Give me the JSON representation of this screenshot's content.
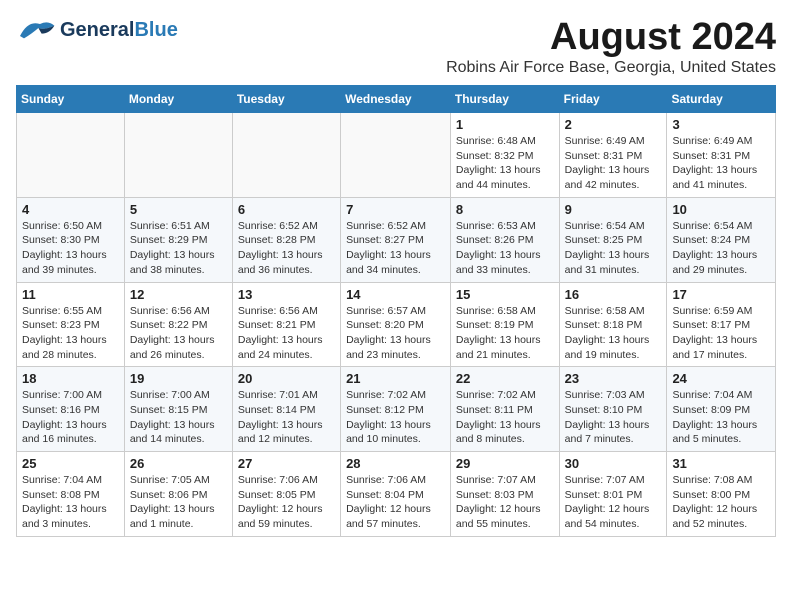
{
  "header": {
    "logo_line1": "General",
    "logo_line2": "Blue",
    "month": "August 2024",
    "location": "Robins Air Force Base, Georgia, United States"
  },
  "weekdays": [
    "Sunday",
    "Monday",
    "Tuesday",
    "Wednesday",
    "Thursday",
    "Friday",
    "Saturday"
  ],
  "weeks": [
    [
      {
        "day": "",
        "info": ""
      },
      {
        "day": "",
        "info": ""
      },
      {
        "day": "",
        "info": ""
      },
      {
        "day": "",
        "info": ""
      },
      {
        "day": "1",
        "info": "Sunrise: 6:48 AM\nSunset: 8:32 PM\nDaylight: 13 hours\nand 44 minutes."
      },
      {
        "day": "2",
        "info": "Sunrise: 6:49 AM\nSunset: 8:31 PM\nDaylight: 13 hours\nand 42 minutes."
      },
      {
        "day": "3",
        "info": "Sunrise: 6:49 AM\nSunset: 8:31 PM\nDaylight: 13 hours\nand 41 minutes."
      }
    ],
    [
      {
        "day": "4",
        "info": "Sunrise: 6:50 AM\nSunset: 8:30 PM\nDaylight: 13 hours\nand 39 minutes."
      },
      {
        "day": "5",
        "info": "Sunrise: 6:51 AM\nSunset: 8:29 PM\nDaylight: 13 hours\nand 38 minutes."
      },
      {
        "day": "6",
        "info": "Sunrise: 6:52 AM\nSunset: 8:28 PM\nDaylight: 13 hours\nand 36 minutes."
      },
      {
        "day": "7",
        "info": "Sunrise: 6:52 AM\nSunset: 8:27 PM\nDaylight: 13 hours\nand 34 minutes."
      },
      {
        "day": "8",
        "info": "Sunrise: 6:53 AM\nSunset: 8:26 PM\nDaylight: 13 hours\nand 33 minutes."
      },
      {
        "day": "9",
        "info": "Sunrise: 6:54 AM\nSunset: 8:25 PM\nDaylight: 13 hours\nand 31 minutes."
      },
      {
        "day": "10",
        "info": "Sunrise: 6:54 AM\nSunset: 8:24 PM\nDaylight: 13 hours\nand 29 minutes."
      }
    ],
    [
      {
        "day": "11",
        "info": "Sunrise: 6:55 AM\nSunset: 8:23 PM\nDaylight: 13 hours\nand 28 minutes."
      },
      {
        "day": "12",
        "info": "Sunrise: 6:56 AM\nSunset: 8:22 PM\nDaylight: 13 hours\nand 26 minutes."
      },
      {
        "day": "13",
        "info": "Sunrise: 6:56 AM\nSunset: 8:21 PM\nDaylight: 13 hours\nand 24 minutes."
      },
      {
        "day": "14",
        "info": "Sunrise: 6:57 AM\nSunset: 8:20 PM\nDaylight: 13 hours\nand 23 minutes."
      },
      {
        "day": "15",
        "info": "Sunrise: 6:58 AM\nSunset: 8:19 PM\nDaylight: 13 hours\nand 21 minutes."
      },
      {
        "day": "16",
        "info": "Sunrise: 6:58 AM\nSunset: 8:18 PM\nDaylight: 13 hours\nand 19 minutes."
      },
      {
        "day": "17",
        "info": "Sunrise: 6:59 AM\nSunset: 8:17 PM\nDaylight: 13 hours\nand 17 minutes."
      }
    ],
    [
      {
        "day": "18",
        "info": "Sunrise: 7:00 AM\nSunset: 8:16 PM\nDaylight: 13 hours\nand 16 minutes."
      },
      {
        "day": "19",
        "info": "Sunrise: 7:00 AM\nSunset: 8:15 PM\nDaylight: 13 hours\nand 14 minutes."
      },
      {
        "day": "20",
        "info": "Sunrise: 7:01 AM\nSunset: 8:14 PM\nDaylight: 13 hours\nand 12 minutes."
      },
      {
        "day": "21",
        "info": "Sunrise: 7:02 AM\nSunset: 8:12 PM\nDaylight: 13 hours\nand 10 minutes."
      },
      {
        "day": "22",
        "info": "Sunrise: 7:02 AM\nSunset: 8:11 PM\nDaylight: 13 hours\nand 8 minutes."
      },
      {
        "day": "23",
        "info": "Sunrise: 7:03 AM\nSunset: 8:10 PM\nDaylight: 13 hours\nand 7 minutes."
      },
      {
        "day": "24",
        "info": "Sunrise: 7:04 AM\nSunset: 8:09 PM\nDaylight: 13 hours\nand 5 minutes."
      }
    ],
    [
      {
        "day": "25",
        "info": "Sunrise: 7:04 AM\nSunset: 8:08 PM\nDaylight: 13 hours\nand 3 minutes."
      },
      {
        "day": "26",
        "info": "Sunrise: 7:05 AM\nSunset: 8:06 PM\nDaylight: 13 hours\nand 1 minute."
      },
      {
        "day": "27",
        "info": "Sunrise: 7:06 AM\nSunset: 8:05 PM\nDaylight: 12 hours\nand 59 minutes."
      },
      {
        "day": "28",
        "info": "Sunrise: 7:06 AM\nSunset: 8:04 PM\nDaylight: 12 hours\nand 57 minutes."
      },
      {
        "day": "29",
        "info": "Sunrise: 7:07 AM\nSunset: 8:03 PM\nDaylight: 12 hours\nand 55 minutes."
      },
      {
        "day": "30",
        "info": "Sunrise: 7:07 AM\nSunset: 8:01 PM\nDaylight: 12 hours\nand 54 minutes."
      },
      {
        "day": "31",
        "info": "Sunrise: 7:08 AM\nSunset: 8:00 PM\nDaylight: 12 hours\nand 52 minutes."
      }
    ]
  ]
}
